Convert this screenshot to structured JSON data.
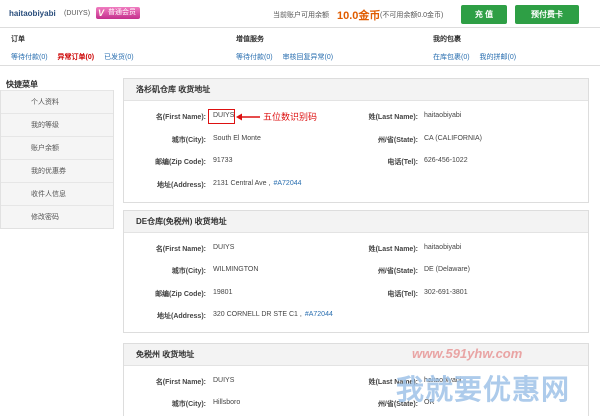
{
  "header": {
    "username": "haitaobiyabi",
    "user_code": "(DUIYS)",
    "vip_label": "普通会员",
    "vip_letter": "V",
    "balance_label": "当前账户可用余额",
    "balance_value": "10.0金币",
    "frozen_text": "(不可用余额0.0金币)",
    "recharge_label": "充 值",
    "prepaid_label": "预付费卡"
  },
  "summary": {
    "orders": {
      "title": "订单",
      "links": [
        "等待付款(0)",
        "异常订单(0)",
        "已发货(0)"
      ]
    },
    "value_added": {
      "title": "增值服务",
      "links": [
        "等待付款(0)",
        "审核回复异常(0)"
      ]
    },
    "packages": {
      "title": "我的包裹",
      "links": [
        "在库包裹(0)",
        "我的拼邮(0)"
      ]
    }
  },
  "sidebar": {
    "title": "快捷菜单",
    "items": [
      "个人资料",
      "我的等级",
      "账户余额",
      "我的优惠券",
      "收件人信息",
      "修改密码"
    ]
  },
  "panels": [
    {
      "title": "洛杉矶仓库 收货地址",
      "first_name_label": "名(First Name):",
      "first_name": "DUIYS",
      "last_name_label": "姓(Last Name):",
      "last_name": "haitaobiyabi",
      "city_label": "城市(City):",
      "city": "South El Monte",
      "state_label": "州/省(State):",
      "state": "CA (CALIFORNIA)",
      "zip_label": "邮编(Zip Code):",
      "zip": "91733",
      "tel_label": "电话(Tel):",
      "tel": "626-456-1022",
      "address_label": "地址(Address):",
      "address": "2131 Central Ave ,",
      "address_code": "#A72044",
      "annotation": "五位数识别码"
    },
    {
      "title": "DE仓库(免税州) 收货地址",
      "first_name_label": "名(First Name):",
      "first_name": "DUIYS",
      "last_name_label": "姓(Last Name):",
      "last_name": "haitaobiyabi",
      "city_label": "城市(City):",
      "city": "WILMINGTON",
      "state_label": "州/省(State):",
      "state": "DE (Delaware)",
      "zip_label": "邮编(Zip Code):",
      "zip": "19801",
      "tel_label": "电话(Tel):",
      "tel": "302-691-3801",
      "address_label": "地址(Address):",
      "address": "320 CORNELL DR STE C1 ,",
      "address_code": "#A72044"
    },
    {
      "title": "免税州 收货地址",
      "first_name_label": "名(First Name):",
      "first_name": "DUIYS",
      "last_name_label": "姓(Last Name):",
      "last_name": "haitaobiyabi",
      "city_label": "城市(City):",
      "city": "Hillsboro",
      "state_label": "州/省(State):",
      "state": "OR"
    }
  ],
  "watermark": {
    "url": "www.591yhw.com",
    "text": "我就要优惠网"
  }
}
